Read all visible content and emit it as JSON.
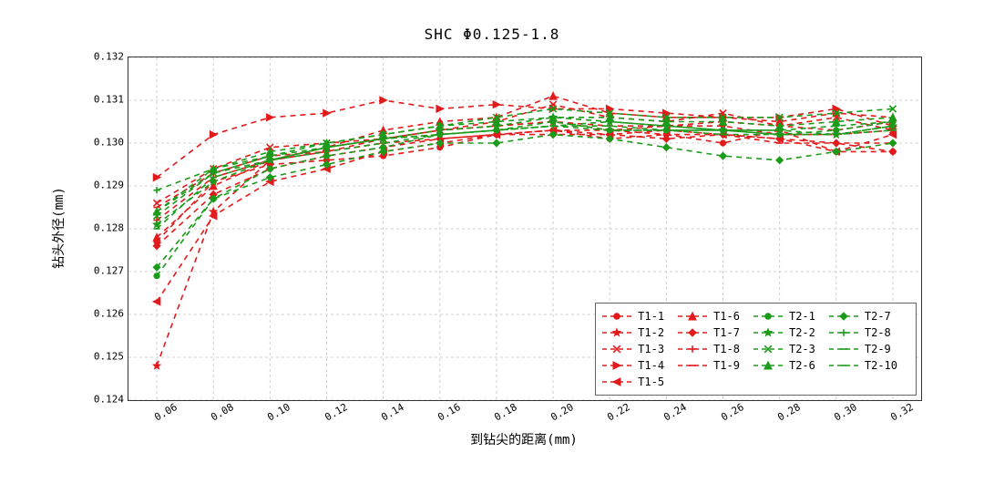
{
  "chart_data": {
    "type": "line",
    "title": "SHC  Φ0.125-1.8",
    "xlabel": "到钻尖的距离(mm)",
    "ylabel": "钻头外径(mm)",
    "xlim": [
      0.05,
      0.33
    ],
    "ylim": [
      0.124,
      0.132
    ],
    "xticks": [
      0.06,
      0.08,
      0.1,
      0.12,
      0.14,
      0.16,
      0.18,
      0.2,
      0.22,
      0.24,
      0.26,
      0.28,
      0.3,
      0.32
    ],
    "yticks": [
      0.124,
      0.125,
      0.126,
      0.127,
      0.128,
      0.129,
      0.13,
      0.131,
      0.132
    ],
    "x": [
      0.06,
      0.08,
      0.1,
      0.12,
      0.14,
      0.16,
      0.18,
      0.2,
      0.22,
      0.24,
      0.26,
      0.28,
      0.3,
      0.32
    ],
    "x_tick_labels": [
      "0.06",
      "0.08",
      "0.10",
      "0.12",
      "0.14",
      "0.16",
      "0.18",
      "0.20",
      "0.22",
      "0.24",
      "0.26",
      "0.28",
      "0.30",
      "0.32"
    ],
    "y_tick_labels": [
      "0.124",
      "0.125",
      "0.126",
      "0.127",
      "0.128",
      "0.129",
      "0.130",
      "0.131",
      "0.132"
    ],
    "grid": true,
    "line_style": "dashed",
    "series": [
      {
        "name": "T1-1",
        "color": "#e31a1c",
        "marker": "circle_filled",
        "values": [
          0.1277,
          0.1291,
          0.1295,
          0.1296,
          0.1297,
          0.1299,
          0.1302,
          0.1303,
          0.1301,
          0.1302,
          0.13,
          0.1303,
          0.1298,
          0.1298
        ]
      },
      {
        "name": "T1-2",
        "color": "#e31a1c",
        "marker": "star_filled",
        "values": [
          0.1248,
          0.1284,
          0.1296,
          0.1298,
          0.1301,
          0.1303,
          0.1304,
          0.1305,
          0.1303,
          0.1304,
          0.1304,
          0.1302,
          0.1302,
          0.1303
        ]
      },
      {
        "name": "T1-3",
        "color": "#e31a1c",
        "marker": "x",
        "values": [
          0.1286,
          0.1294,
          0.1299,
          0.13,
          0.1301,
          0.1303,
          0.1305,
          0.1309,
          0.1306,
          0.1305,
          0.1307,
          0.1304,
          0.1306,
          0.1303
        ]
      },
      {
        "name": "T1-4",
        "color": "#e31a1c",
        "marker": "triangle_right",
        "values": [
          0.1292,
          0.1302,
          0.1306,
          0.1307,
          0.131,
          0.1308,
          0.1309,
          0.1308,
          0.1308,
          0.1307,
          0.1306,
          0.1306,
          0.1308,
          0.1304
        ]
      },
      {
        "name": "T1-5",
        "color": "#e31a1c",
        "marker": "triangle_left",
        "values": [
          0.1263,
          0.1283,
          0.1291,
          0.1294,
          0.1298,
          0.13,
          0.1302,
          0.1303,
          0.1302,
          0.1303,
          0.1302,
          0.1301,
          0.1298,
          0.1302
        ]
      },
      {
        "name": "T1-6",
        "color": "#e31a1c",
        "marker": "triangle_up",
        "values": [
          0.1278,
          0.129,
          0.1296,
          0.1299,
          0.1303,
          0.1305,
          0.1306,
          0.1311,
          0.1307,
          0.1306,
          0.1306,
          0.1305,
          0.1307,
          0.1306
        ]
      },
      {
        "name": "T1-7",
        "color": "#e31a1c",
        "marker": "diamond_filled",
        "values": [
          0.1276,
          0.1288,
          0.1294,
          0.1297,
          0.1299,
          0.1301,
          0.1302,
          0.1302,
          0.1302,
          0.1301,
          0.1302,
          0.1301,
          0.13,
          0.1298
        ]
      },
      {
        "name": "T1-8",
        "color": "#e31a1c",
        "marker": "plus",
        "values": [
          0.1282,
          0.1292,
          0.1296,
          0.1299,
          0.1301,
          0.1303,
          0.1304,
          0.1305,
          0.1304,
          0.1304,
          0.1305,
          0.1304,
          0.1303,
          0.1305
        ]
      },
      {
        "name": "T1-9",
        "color": "#e31a1c",
        "marker": "dash",
        "values": [
          0.1285,
          0.1293,
          0.1297,
          0.1298,
          0.13,
          0.1301,
          0.1302,
          0.1303,
          0.1303,
          0.1302,
          0.1302,
          0.13,
          0.13,
          0.13
        ]
      },
      {
        "name": "T2-1",
        "color": "#1a9b1a",
        "marker": "circle_filled",
        "values": [
          0.1269,
          0.1287,
          0.1294,
          0.1297,
          0.1299,
          0.1302,
          0.1303,
          0.1305,
          0.1303,
          0.1303,
          0.1303,
          0.1302,
          0.1303,
          0.1305
        ]
      },
      {
        "name": "T2-2",
        "color": "#1a9b1a",
        "marker": "star_filled",
        "values": [
          0.1281,
          0.1291,
          0.1296,
          0.1299,
          0.1301,
          0.1303,
          0.1304,
          0.1306,
          0.1305,
          0.1304,
          0.1303,
          0.1303,
          0.1302,
          0.1304
        ]
      },
      {
        "name": "T2-3",
        "color": "#1a9b1a",
        "marker": "x",
        "values": [
          0.1283,
          0.1293,
          0.1297,
          0.13,
          0.1302,
          0.1304,
          0.1306,
          0.1308,
          0.1307,
          0.1306,
          0.1306,
          0.1306,
          0.1307,
          0.1308
        ]
      },
      {
        "name": "T2-6",
        "color": "#1a9b1a",
        "marker": "triangle_up",
        "values": [
          0.1284,
          0.1294,
          0.1298,
          0.13,
          0.1302,
          0.1304,
          0.1305,
          0.1306,
          0.1306,
          0.1305,
          0.1305,
          0.1304,
          0.1305,
          0.1306
        ]
      },
      {
        "name": "T2-7",
        "color": "#1a9b1a",
        "marker": "diamond_filled",
        "values": [
          0.1271,
          0.1287,
          0.1292,
          0.1295,
          0.1298,
          0.13,
          0.13,
          0.1302,
          0.1301,
          0.1299,
          0.1297,
          0.1296,
          0.1298,
          0.13
        ]
      },
      {
        "name": "T2-8",
        "color": "#1a9b1a",
        "marker": "plus",
        "values": [
          0.1289,
          0.1294,
          0.1297,
          0.1299,
          0.1301,
          0.1302,
          0.1303,
          0.1304,
          0.1305,
          0.1304,
          0.1303,
          0.1303,
          0.1304,
          0.1305
        ]
      },
      {
        "name": "T2-9",
        "color": "#1a9b1a",
        "marker": "dash",
        "values": [
          0.128,
          0.1292,
          0.1296,
          0.1298,
          0.13,
          0.1302,
          0.1303,
          0.1304,
          0.1303,
          0.1303,
          0.1302,
          0.1302,
          0.1302,
          0.1303
        ]
      },
      {
        "name": "T2-10",
        "color": "#1a9b1a",
        "marker": "dash_short",
        "values": [
          0.1284,
          0.1293,
          0.1296,
          0.1299,
          0.1301,
          0.1302,
          0.1303,
          0.1304,
          0.1304,
          0.1303,
          0.1303,
          0.1302,
          0.1302,
          0.1304
        ]
      }
    ],
    "legend_columns": [
      [
        "T1-1",
        "T1-2",
        "T1-3",
        "T1-4",
        "T1-5"
      ],
      [
        "T1-6",
        "T1-7",
        "T1-8",
        "T1-9"
      ],
      [
        "T2-1",
        "T2-2",
        "T2-3",
        "T2-6"
      ],
      [
        "T2-7",
        "T2-8",
        "T2-9",
        "T2-10"
      ]
    ]
  }
}
